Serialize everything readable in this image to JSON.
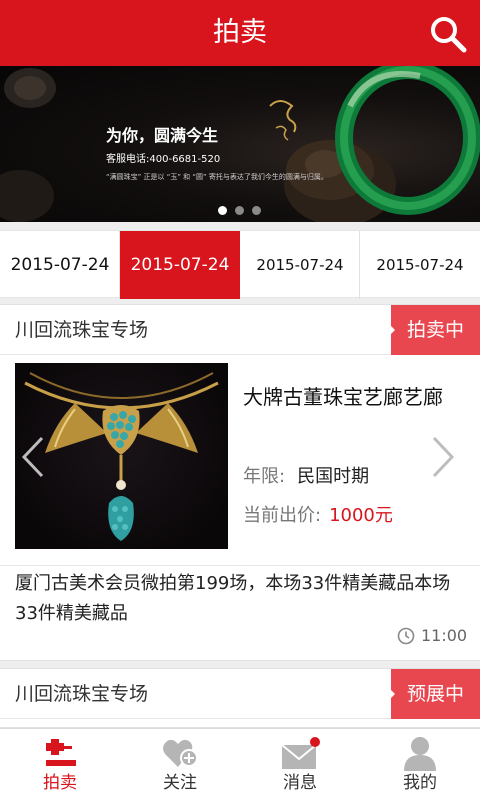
{
  "header": {
    "title": "拍卖"
  },
  "banner": {
    "slogan": "为你，圆满今生",
    "phone": "客服电话:400-6681-520",
    "subtitle": "“满圆珠宝” 正是以 “玉” 和 “圆” 寄托与表达了我们今生的圆满与归属。",
    "active_slide": 1,
    "slide_count": 3
  },
  "date_tabs": [
    {
      "label": "2015-07-24",
      "active": false
    },
    {
      "label": "2015-07-24",
      "active": true
    },
    {
      "label": "2015-07-24",
      "active": false
    },
    {
      "label": "2015-07-24",
      "active": false
    }
  ],
  "auctions": [
    {
      "name": "川回流珠宝专场",
      "status": "拍卖中",
      "item_title": "大牌古董珠宝艺廊艺廊",
      "era_label": "年限:",
      "era_value": "民国时期",
      "bid_label": "当前出价:",
      "bid_value": "1000元",
      "description": "厦门古美术会员微拍第199场，本场33件精美藏品本场33件精美藏品",
      "time": "11:00"
    },
    {
      "name": "川回流珠宝专场",
      "status": "预展中"
    }
  ],
  "tabbar": [
    {
      "label": "拍卖",
      "icon": "gavel-icon",
      "active": true
    },
    {
      "label": "关注",
      "icon": "heart-plus-icon",
      "active": false
    },
    {
      "label": "消息",
      "icon": "envelope-icon",
      "active": false,
      "badge_dot": true
    },
    {
      "label": "我的",
      "icon": "person-icon",
      "active": false
    }
  ],
  "colors": {
    "brand_red": "#d8141c",
    "badge_red": "#e8474f",
    "accent_red_text": "#d8141c"
  }
}
